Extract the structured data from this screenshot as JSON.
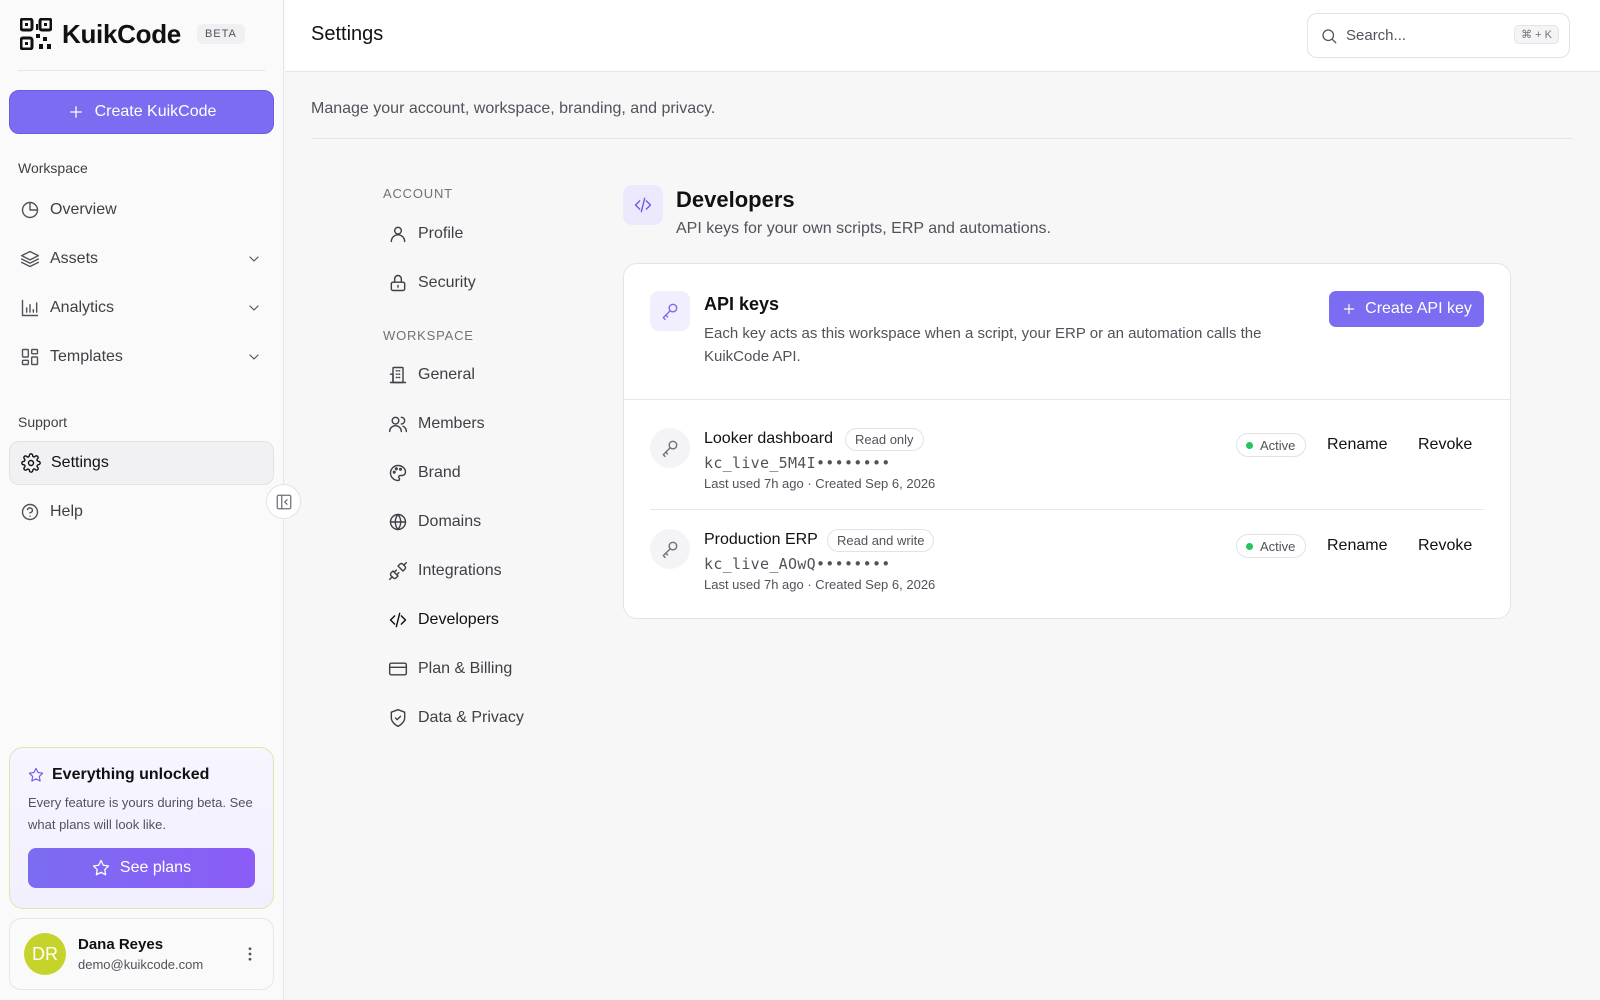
{
  "app": {
    "brand": "KuikCode",
    "badge": "BETA",
    "create_label": "Create KuikCode"
  },
  "sidebar": {
    "workspace_label": "Workspace",
    "support_label": "Support",
    "items": [
      {
        "label": "Overview",
        "icon": "pie-chart-icon"
      },
      {
        "label": "Assets",
        "icon": "layers-icon"
      },
      {
        "label": "Analytics",
        "icon": "bar-chart-icon"
      },
      {
        "label": "Templates",
        "icon": "layout-grid-icon"
      },
      {
        "label": "Settings",
        "icon": "gear-icon",
        "active": true
      },
      {
        "label": "Help",
        "icon": "help-circle-icon"
      }
    ],
    "promo": {
      "title": "Everything unlocked",
      "text": "Every feature is yours during beta. See what plans will look like.",
      "button": "See plans"
    },
    "user": {
      "initials": "DR",
      "name": "Dana Reyes",
      "email": "demo@kuikcode.com",
      "avatar_color": "#c5d32a"
    }
  },
  "header": {
    "title": "Settings",
    "search_placeholder": "Search...",
    "search_shortcut": "⌘ + K"
  },
  "main": {
    "subtitle": "Manage your account, workspace, branding, and privacy."
  },
  "settings_nav": {
    "account_label": "ACCOUNT",
    "workspace_label": "WORKSPACE",
    "items": [
      {
        "label": "Profile",
        "icon": "user-icon"
      },
      {
        "label": "Security",
        "icon": "lock-icon"
      },
      {
        "label": "General",
        "icon": "building-icon"
      },
      {
        "label": "Members",
        "icon": "users-icon"
      },
      {
        "label": "Brand",
        "icon": "palette-icon"
      },
      {
        "label": "Domains",
        "icon": "globe-icon"
      },
      {
        "label": "Integrations",
        "icon": "plug-icon"
      },
      {
        "label": "Developers",
        "icon": "code-icon",
        "active": true
      },
      {
        "label": "Plan & Billing",
        "icon": "credit-card-icon"
      },
      {
        "label": "Data & Privacy",
        "icon": "shield-check-icon"
      }
    ]
  },
  "developers": {
    "title": "Developers",
    "description": "API keys for your own scripts, ERP and automations.",
    "card": {
      "title": "API keys",
      "description": "Each key acts as this workspace when a script, your ERP or an automation calls the KuikCode API.",
      "create_button": "Create API key"
    },
    "keys": [
      {
        "name": "Looker dashboard",
        "permission": "Read only",
        "code": "kc_live_5M4I••••••••",
        "meta": "Last used 7h ago · Created Sep 6, 2026",
        "status": "Active",
        "rename": "Rename",
        "revoke": "Revoke"
      },
      {
        "name": "Production ERP",
        "permission": "Read and write",
        "code": "kc_live_AOwQ••••••••",
        "meta": "Last used 7h ago · Created Sep 6, 2026",
        "status": "Active",
        "rename": "Rename",
        "revoke": "Revoke"
      }
    ]
  },
  "colors": {
    "accent": "#7c6cf2",
    "status_active": "#22c55e"
  }
}
